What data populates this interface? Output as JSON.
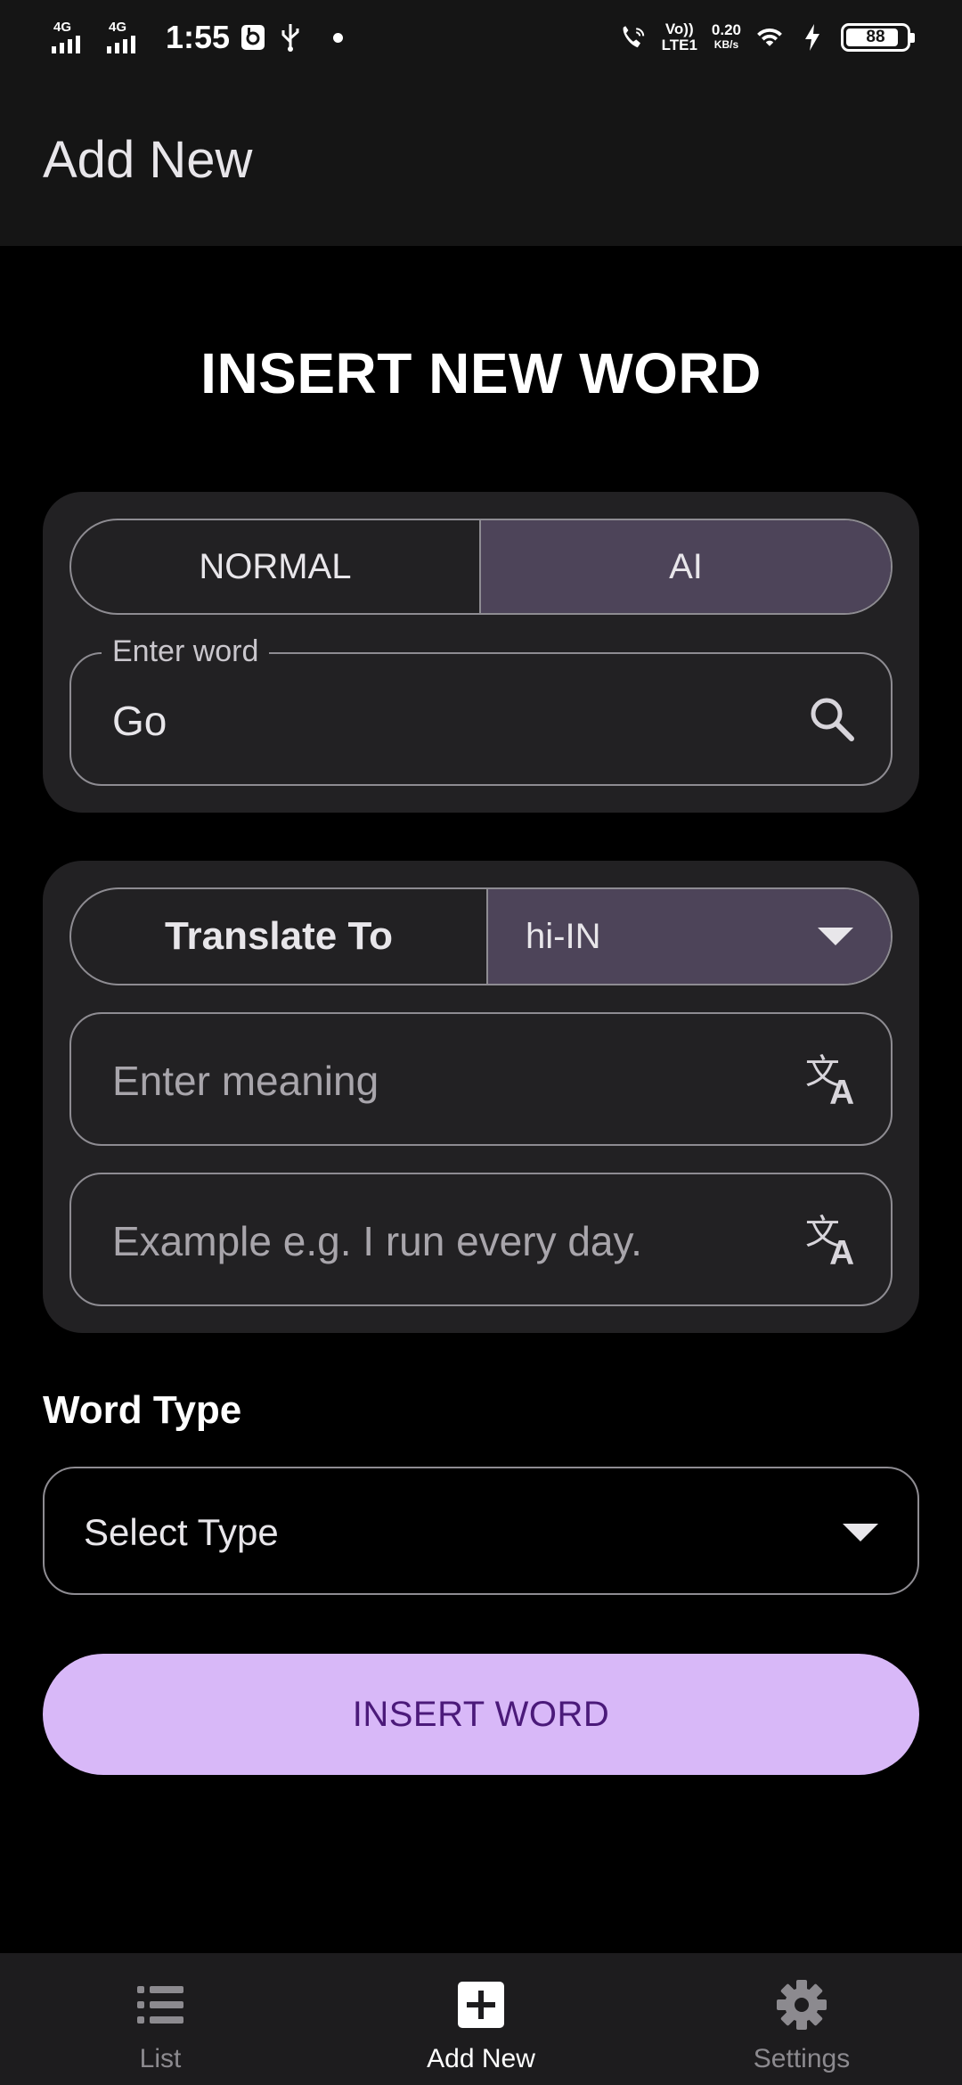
{
  "status_bar": {
    "network_1": "4G",
    "network_2": "4G",
    "time": "1:55",
    "volte_top": "Vo))",
    "volte_bottom": "LTE1",
    "speed_value": "0.20",
    "speed_unit": "KB/s",
    "battery": "88",
    "battery_level": 0.88
  },
  "app_bar": {
    "title": "Add New"
  },
  "heading": "INSERT NEW WORD",
  "mode_toggle": {
    "normal_label": "NORMAL",
    "ai_label": "AI",
    "selected": "AI"
  },
  "word_field": {
    "label": "Enter word",
    "value": "Go",
    "icon": "search-icon"
  },
  "translate": {
    "label": "Translate To",
    "language": "hi-IN",
    "meaning_placeholder": "Enter meaning",
    "example_placeholder": "Example e.g. I run every day.",
    "icon": "translate-icon"
  },
  "word_type": {
    "label": "Word Type",
    "placeholder": "Select Type"
  },
  "insert_button": {
    "label": "INSERT WORD"
  },
  "bottom_nav": {
    "items": [
      {
        "label": "List",
        "icon": "list-icon",
        "active": false
      },
      {
        "label": "Add New",
        "icon": "add-box-icon",
        "active": true
      },
      {
        "label": "Settings",
        "icon": "gear-icon",
        "active": false
      }
    ]
  },
  "colors": {
    "background": "#000000",
    "bar": "#151515",
    "card": "#222123",
    "segment_selected": "#4d4459",
    "primary_button": "#d8b8f8",
    "primary_button_text": "#4b1a7a"
  }
}
